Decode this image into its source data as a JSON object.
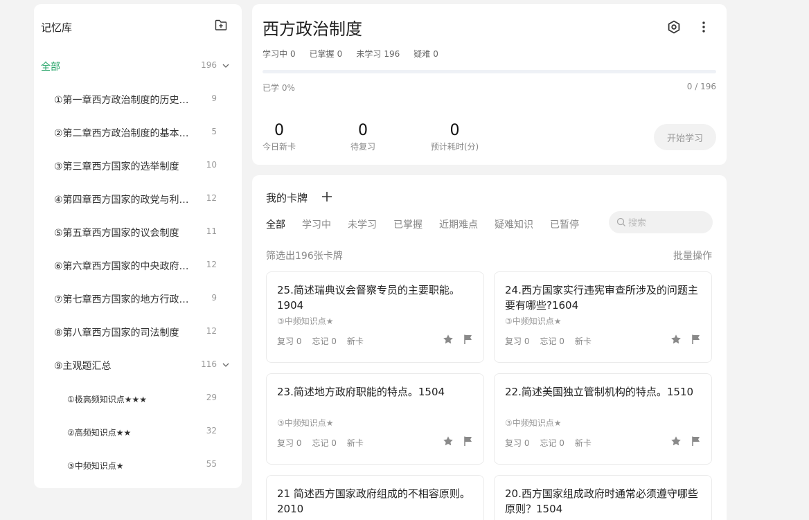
{
  "sidebar": {
    "title": "记忆库",
    "items": [
      {
        "label": "全部",
        "count": "196"
      },
      {
        "label": "①第一章西方政治制度的历史…",
        "count": "9"
      },
      {
        "label": "②第二章西方政治制度的基本…",
        "count": "5"
      },
      {
        "label": "③第三章西方国家的选举制度",
        "count": "10"
      },
      {
        "label": "④第四章西方国家的政党与利…",
        "count": "12"
      },
      {
        "label": "⑤第五章西方国家的议会制度",
        "count": "11"
      },
      {
        "label": "⑥第六章西方国家的中央政府…",
        "count": "12"
      },
      {
        "label": "⑦第七章西方国家的地方行政…",
        "count": "9"
      },
      {
        "label": "⑧第八章西方国家的司法制度",
        "count": "12"
      },
      {
        "label": "⑨主观题汇总",
        "count": "116"
      },
      {
        "label": "①极高频知识点★★★",
        "count": "29"
      },
      {
        "label": "②高频知识点★★",
        "count": "32"
      },
      {
        "label": "③中频知识点★",
        "count": "55"
      }
    ]
  },
  "deck": {
    "title": "西方政治制度",
    "stats": [
      {
        "label": "学习中",
        "value": "0"
      },
      {
        "label": "已掌握",
        "value": "0"
      },
      {
        "label": "未学习",
        "value": "196"
      },
      {
        "label": "疑难",
        "value": "0"
      }
    ],
    "learned_label": "已学 0%",
    "progress_fraction": 0,
    "ratio": "0 / 196",
    "metrics": [
      {
        "value": "0",
        "label": "今日新卡"
      },
      {
        "value": "0",
        "label": "待复习"
      },
      {
        "value": "0",
        "label": "预计耗时(分)"
      }
    ],
    "start_label": "开始学习"
  },
  "cards_panel": {
    "title": "我的卡牌",
    "tabs": [
      "全部",
      "学习中",
      "未学习",
      "已掌握",
      "近期难点",
      "疑难知识",
      "已暂停"
    ],
    "search_placeholder": "搜索",
    "filter_info": "筛选出196张卡牌",
    "bulk_label": "批量操作",
    "cards": [
      {
        "question": "25.简述瑞典议会督察专员的主要职能。1904",
        "tag": "③中频知识点★",
        "review": "复习 0",
        "forget": "忘记 0",
        "status": "新卡"
      },
      {
        "question": "24.西方国家实行违宪审查所涉及的问题主要有哪些?1604",
        "tag": "③中频知识点★",
        "review": "复习 0",
        "forget": "忘记 0",
        "status": "新卡"
      },
      {
        "question": "23.简述地方政府职能的特点。1504",
        "tag": "③中频知识点★",
        "review": "复习 0",
        "forget": "忘记 0",
        "status": "新卡"
      },
      {
        "question": "22.简述美国独立管制机构的特点。1510",
        "tag": "③中频知识点★",
        "review": "复习 0",
        "forget": "忘记 0",
        "status": "新卡"
      },
      {
        "question": "21 简述西方国家政府组成的不相容原则。2010",
        "tag": "",
        "review": "",
        "forget": "",
        "status": ""
      },
      {
        "question": "20.西方国家组成政府时通常必须遵守哪些原则？1504",
        "tag": "",
        "review": "",
        "forget": "",
        "status": ""
      }
    ]
  },
  "colors": {
    "accent": "#2aa66b",
    "icon_gray": "#888888"
  }
}
